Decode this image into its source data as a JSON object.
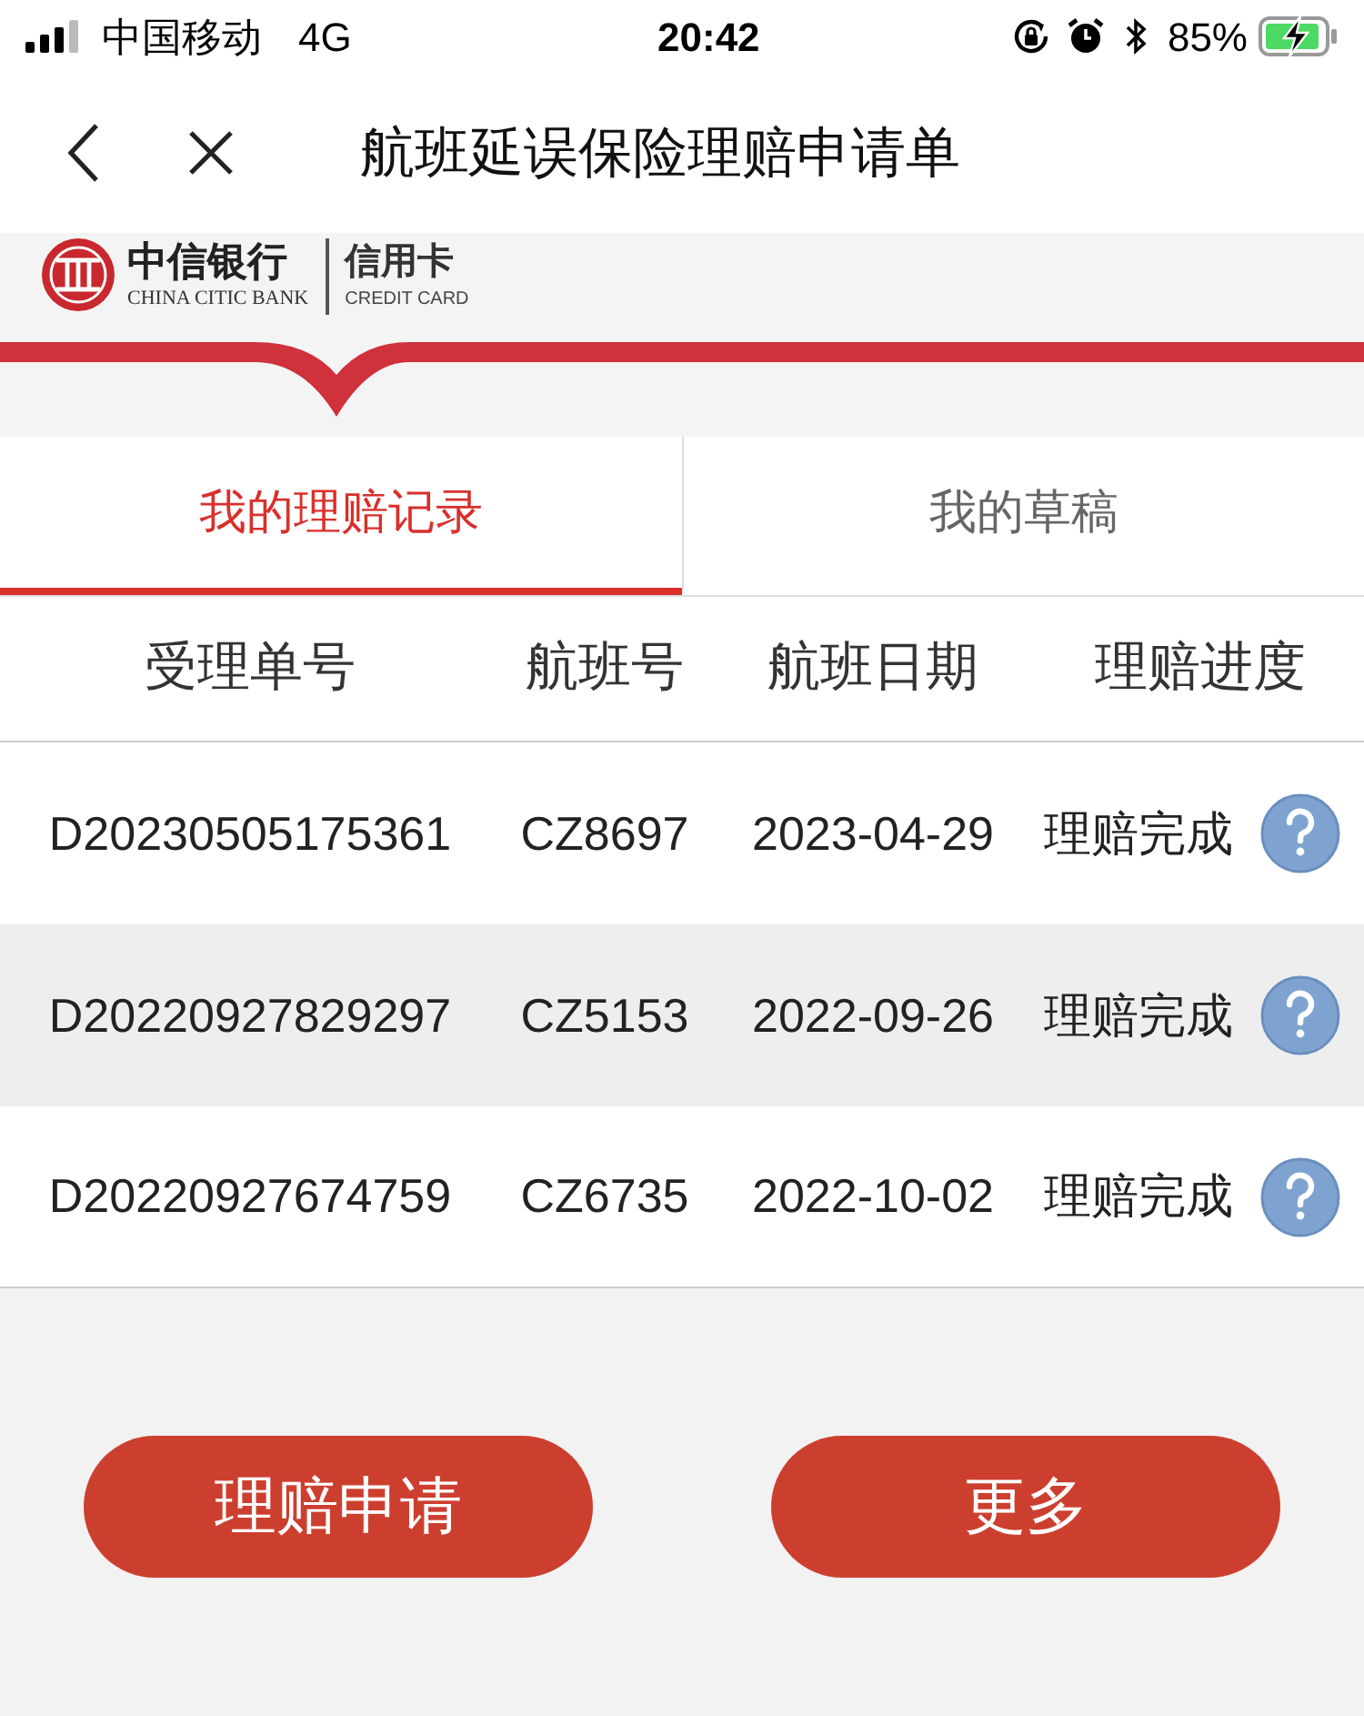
{
  "status_bar": {
    "carrier": "中国移动",
    "network": "4G",
    "time": "20:42",
    "battery": "85%"
  },
  "nav": {
    "title": "航班延误保险理赔申请单"
  },
  "brand": {
    "bank_cn": "中信银行",
    "bank_en": "CHINA CITIC BANK",
    "product_cn": "信用卡",
    "product_en": "CREDIT CARD"
  },
  "tabs": [
    {
      "label": "我的理赔记录",
      "selected": true
    },
    {
      "label": "我的草稿",
      "selected": false
    }
  ],
  "table": {
    "columns": [
      "受理单号",
      "航班号",
      "航班日期",
      "理赔进度"
    ],
    "rows": [
      {
        "number": "D20230505175361",
        "flight": "CZ8697",
        "date": "2023-04-29",
        "status": "理赔完成"
      },
      {
        "number": "D20220927829297",
        "flight": "CZ5153",
        "date": "2022-09-26",
        "status": "理赔完成"
      },
      {
        "number": "D20220927674759",
        "flight": "CZ6735",
        "date": "2022-10-02",
        "status": "理赔完成"
      }
    ]
  },
  "buttons": [
    "理赔申请",
    "更多"
  ]
}
